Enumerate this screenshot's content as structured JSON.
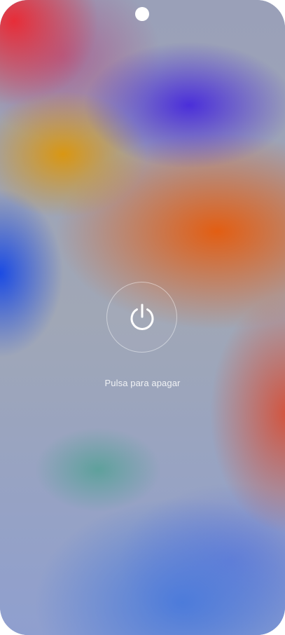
{
  "screen": {
    "name": "power-off-screen"
  },
  "power": {
    "icon": "power-icon",
    "hint_text": "Pulsa para apagar"
  },
  "colors": {
    "ring": "#ffffff",
    "icon": "#ffffff",
    "hint_text": "#ffffff"
  }
}
